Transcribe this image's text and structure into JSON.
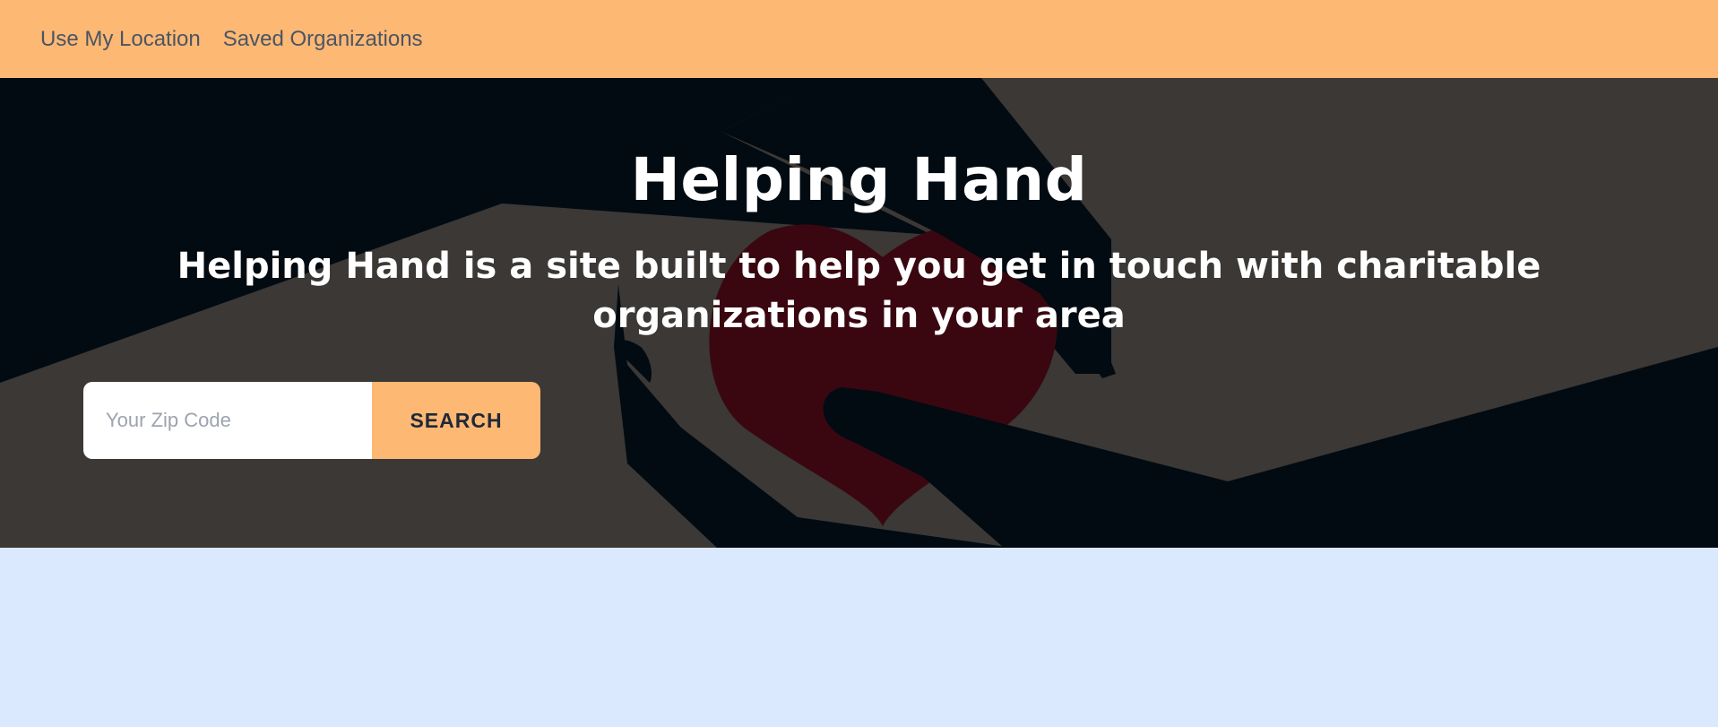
{
  "nav": {
    "items": [
      {
        "label": "Use My Location"
      },
      {
        "label": "Saved Organizations"
      }
    ]
  },
  "hero": {
    "title": "Helping Hand",
    "subtitle": "Helping Hand is a site built to help you get in touch with charitable organizations in your area"
  },
  "search": {
    "placeholder": "Your Zip Code",
    "value": "",
    "button_label": "SEARCH"
  },
  "colors": {
    "nav_bg": "#fdb874",
    "hero_bg": "#3b3835",
    "hand_dark": "#020b12",
    "heart": "#3a0710",
    "page_bg": "#dbe9fe"
  },
  "icons": {
    "hero_background": "hands-holding-heart-illustration"
  }
}
